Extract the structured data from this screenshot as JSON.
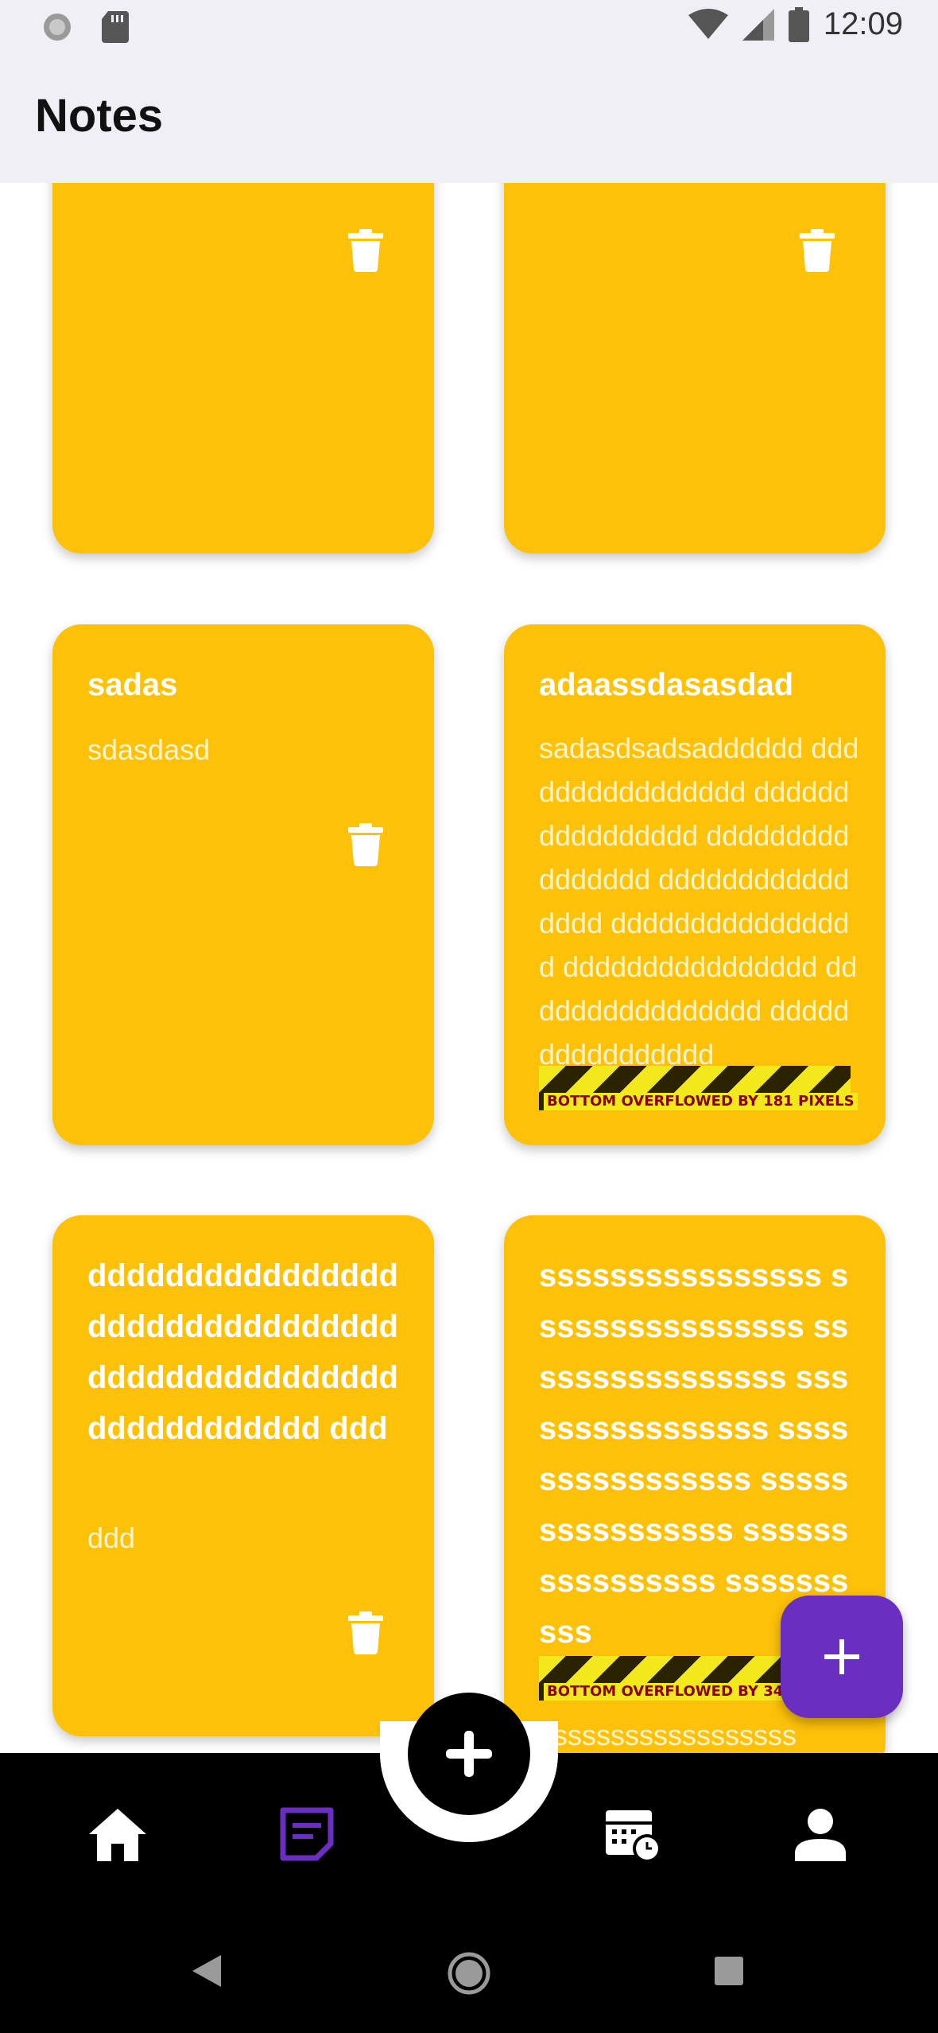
{
  "status_bar": {
    "time": "12:09"
  },
  "app_bar": {
    "title": "Notes"
  },
  "notes": [
    {
      "title": "",
      "body": ""
    },
    {
      "title": "",
      "body": ""
    },
    {
      "title": "sadas",
      "body": "sdasdasd"
    },
    {
      "title": "adaassdasasdad",
      "body": "sadasdsadsadddddd dddddddddddddddd dddddddddddddddd dddddddddddddddd dddddddddddddddd dddddddddddddddd dddddddddddddddd dddddddddddddddd dddddddddddddddd",
      "overflow": "BOTTOM OVERFLOWED BY 181 PIXELS"
    },
    {
      "title": "dddddddddddddddddddddddddddddddddddddddddddddddddddddddddddd ddd",
      "body": "ddd"
    },
    {
      "title": "ssssssssssssssss ssssssssssssssss ssssssssssssssss ssssssssssssssss ssssssssssssssss ssssssssssssssss ssssssssssssssss ssssssssss",
      "body": "ssssssssssssssssss",
      "overflow": "BOTTOM OVERFLOWED BY 342 PIXELS"
    }
  ],
  "icons": {
    "delete": "trash-icon",
    "add": "plus-icon",
    "nav": [
      "home-icon",
      "notes-icon",
      "calendar-clock-icon",
      "person-icon"
    ]
  },
  "colors": {
    "card": "#fdc10a",
    "fab": "#6a2fc0",
    "nav_active": "#6a2fc0",
    "app_bar": "#f0eff6"
  }
}
